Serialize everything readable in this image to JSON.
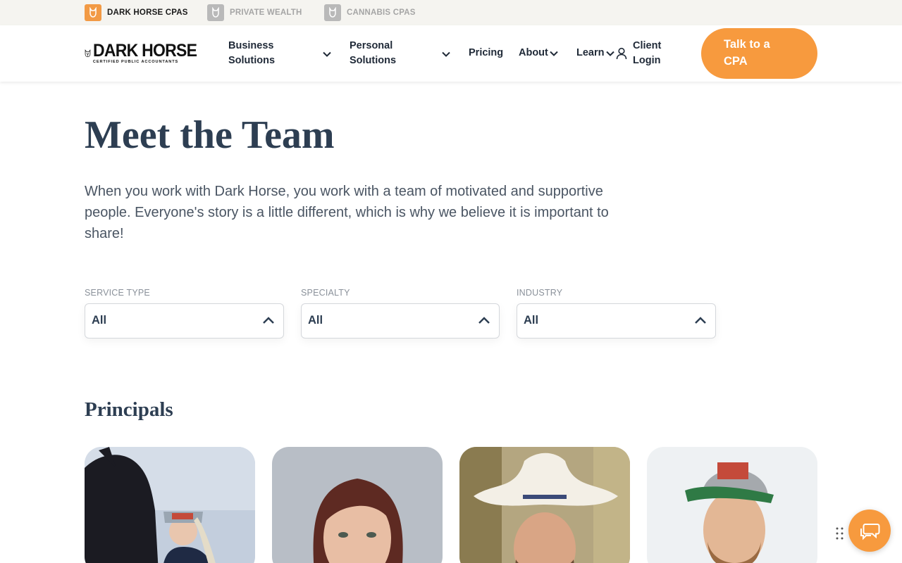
{
  "brands": [
    {
      "label": "DARK HORSE CPAS",
      "active": true
    },
    {
      "label": "PRIVATE WEALTH",
      "active": false
    },
    {
      "label": "CANNABIS CPAS",
      "active": false
    }
  ],
  "logo": {
    "line1": "DARK HORSE",
    "line2": "CERTIFIED PUBLIC ACCOUNTANTS"
  },
  "nav": {
    "business_line1": "Business",
    "business_line2": "Solutions",
    "personal_line1": "Personal",
    "personal_line2": "Solutions",
    "pricing": "Pricing",
    "about": "About",
    "learn": "Learn",
    "login_line1": "Client",
    "login_line2": "Login"
  },
  "cta": {
    "line1": "Talk to a",
    "line2": "CPA"
  },
  "hero": {
    "title": "Meet the Team",
    "intro": "When you work with Dark Horse, you work with a team of motivated and supportive people. Everyone's story is a little different, which is why we believe it is important to share!"
  },
  "filters": [
    {
      "label": "SERVICE TYPE",
      "value": "All"
    },
    {
      "label": "SPECIALTY",
      "value": "All"
    },
    {
      "label": "INDUSTRY",
      "value": "All"
    }
  ],
  "section_title": "Principals",
  "colors": {
    "accent": "#f79a3e",
    "heading": "#2d3e52",
    "body": "#4a5563"
  },
  "icons": {
    "brand_mark": "horse-head-icon",
    "dropdown": "chevron-down-icon",
    "filter_toggle": "chevron-up-icon",
    "login": "user-icon",
    "chat": "chat-bubbles-icon",
    "drag": "drag-handle-icon"
  }
}
